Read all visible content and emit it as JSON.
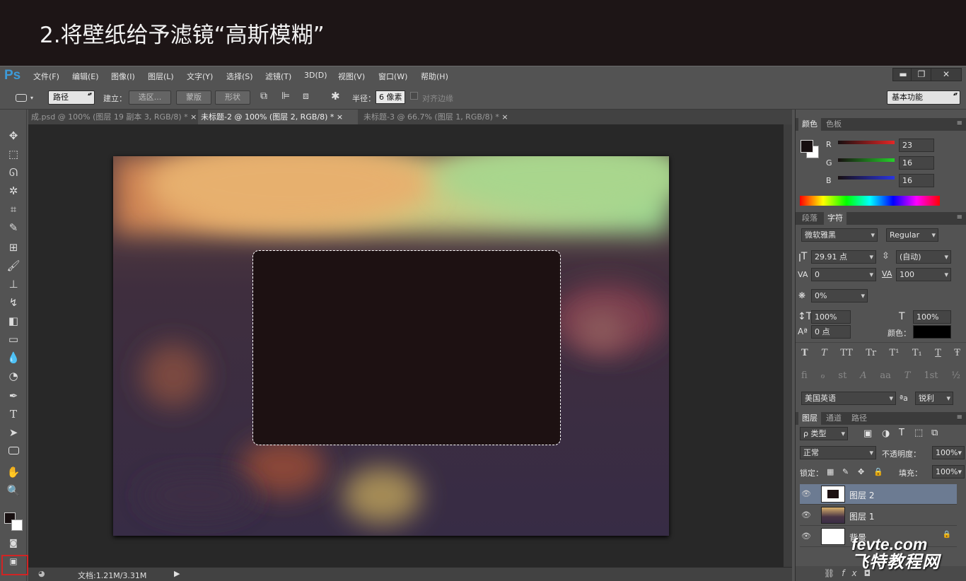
{
  "banner": {
    "title": "2.将壁纸给予滤镜“高斯模糊”"
  },
  "app": {
    "logo": "Ps"
  },
  "menu": [
    "文件(F)",
    "编辑(E)",
    "图像(I)",
    "图层(L)",
    "文字(Y)",
    "选择(S)",
    "滤镜(T)",
    "3D(D)",
    "视图(V)",
    "窗口(W)",
    "帮助(H)"
  ],
  "window_controls": {
    "minimize": "▬",
    "restore": "❐",
    "close": "✕"
  },
  "options": {
    "mode": "路径",
    "create_label": "建立：",
    "selection": "选区...",
    "mask": "蒙版",
    "shape": "形状",
    "radius_label": "半径：",
    "radius_value": "6 像素",
    "align_edges": "对齐边缘",
    "workspace": "基本功能"
  },
  "tabs": [
    {
      "label": "成.psd @ 100% (图层 19 副本 3, RGB/8) *",
      "close": "×"
    },
    {
      "label": "未标题-2 @ 100% (图层 2, RGB/8) *",
      "close": "×"
    },
    {
      "label": "未标题-3 @ 66.7% (图层 1, RGB/8) *",
      "close": "×"
    }
  ],
  "status": {
    "doc": "文档:1.21M/3.31M"
  },
  "colors": {
    "document_bg": "#1d1112",
    "accent_highlight": "#d12424",
    "brand_blue": "#3d9ad8",
    "foreground": "#170f10",
    "background": "#ffffff"
  },
  "color_panel": {
    "tabs": [
      "颜色",
      "色板"
    ],
    "r_label": "R",
    "g_label": "G",
    "b_label": "B",
    "r": "23",
    "g": "16",
    "b": "16"
  },
  "char_panel": {
    "tabs": [
      "段落",
      "字符"
    ],
    "font": "微软雅黑",
    "style": "Regular",
    "size": "29.91 点",
    "leading": "(自动)",
    "kerning": "0",
    "tracking": "100",
    "tsume": "0%",
    "vscale": "100%",
    "hscale": "100%",
    "baseline": "0 点",
    "color_label": "颜色：",
    "language": "美国英语",
    "aa_icon": "ªa",
    "antialias": "锐利",
    "style_buttons": [
      "T",
      "T",
      "TT",
      "Tr",
      "T¹",
      "T₁",
      "T",
      "Ŧ"
    ],
    "opentype_buttons": [
      "fi",
      "ℴ",
      "st",
      "A",
      "aa",
      "T",
      "1st",
      "½"
    ]
  },
  "layers_panel": {
    "tabs": [
      "图层",
      "通道",
      "路径"
    ],
    "filter": "ρ 类型",
    "blend": "正常",
    "opacity_label": "不透明度：",
    "opacity": "100%",
    "lock_label": "锁定：",
    "fill_label": "填充：",
    "fill": "100%",
    "layers": [
      {
        "name": "图层 2"
      },
      {
        "name": "图层 1"
      },
      {
        "name": "背景"
      }
    ]
  },
  "watermark": {
    "line1": "fevte.com",
    "line2": "飞特教程网"
  }
}
